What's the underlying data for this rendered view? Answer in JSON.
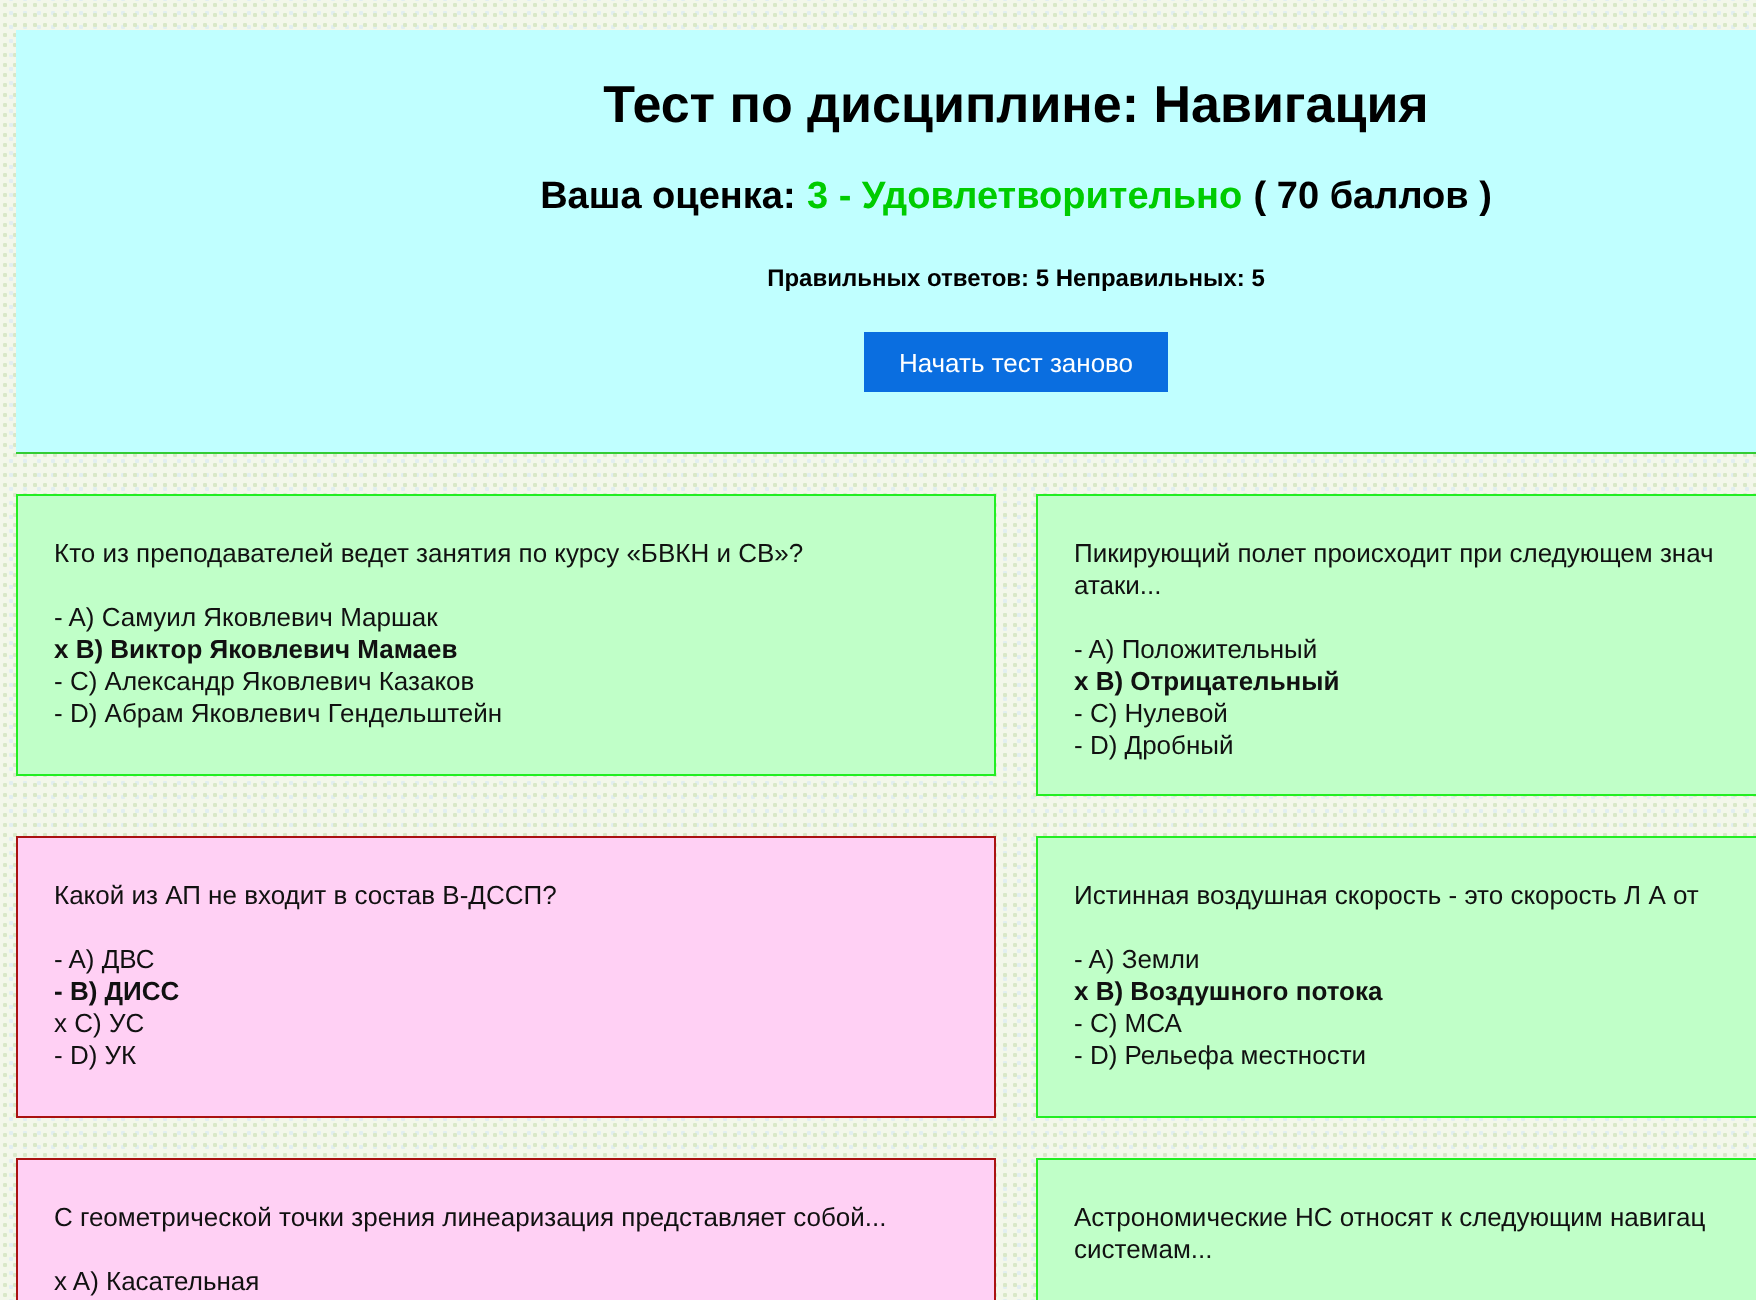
{
  "header": {
    "title": "Тест по дисциплине: Навигация",
    "score_label": "Ваша оценка:",
    "grade": "3 - Удовлетворительно",
    "points": "( 70 баллов )",
    "summary": "Правильных ответов: 5 Неправильных: 5",
    "restart_button": "Начать тест заново"
  },
  "questions": [
    {
      "answered_correctly": true,
      "question": [
        "Кто из преподавателей ведет занятия по курсу «БВКН и СВ»?"
      ],
      "answers": [
        {
          "text": "- A) Самуил Яковлевич Маршак",
          "correct": false
        },
        {
          "text": "x B) Виктор Яковлевич Мамаев",
          "correct": true
        },
        {
          "text": "- C) Александр Яковлевич Казаков",
          "correct": false
        },
        {
          "text": "- D) Абрам Яковлевич Гендельштейн",
          "correct": false
        }
      ]
    },
    {
      "answered_correctly": true,
      "question": [
        "Пикирующий полет происходит при следующем знач",
        "атаки..."
      ],
      "answers": [
        {
          "text": "- A) Положительный",
          "correct": false
        },
        {
          "text": "x B) Отрицательный",
          "correct": true
        },
        {
          "text": "- C) Нулевой",
          "correct": false
        },
        {
          "text": "- D) Дробный",
          "correct": false
        }
      ]
    },
    {
      "answered_correctly": false,
      "question": [
        "Какой из АП не входит в состав В-ДССП?"
      ],
      "answers": [
        {
          "text": "- A) ДВС",
          "correct": false
        },
        {
          "text": "- B) ДИСС",
          "correct": true
        },
        {
          "text": "x C) УС",
          "correct": false
        },
        {
          "text": "- D) УК",
          "correct": false
        }
      ]
    },
    {
      "answered_correctly": true,
      "question": [
        "Истинная воздушная скорость - это скорость Л А от"
      ],
      "answers": [
        {
          "text": "- A) Земли",
          "correct": false
        },
        {
          "text": "x B) Воздушного потока",
          "correct": true
        },
        {
          "text": "- C) МСА",
          "correct": false
        },
        {
          "text": "- D) Рельефа местности",
          "correct": false
        }
      ]
    },
    {
      "answered_correctly": false,
      "question": [
        "С геометрической точки зрения линеаризация представляет собой..."
      ],
      "answers": [
        {
          "text": "x A) Касательная",
          "correct": false
        }
      ]
    },
    {
      "answered_correctly": true,
      "question": [
        "Астрономические НС относят к следующим навигац",
        "системам..."
      ]
    }
  ]
}
